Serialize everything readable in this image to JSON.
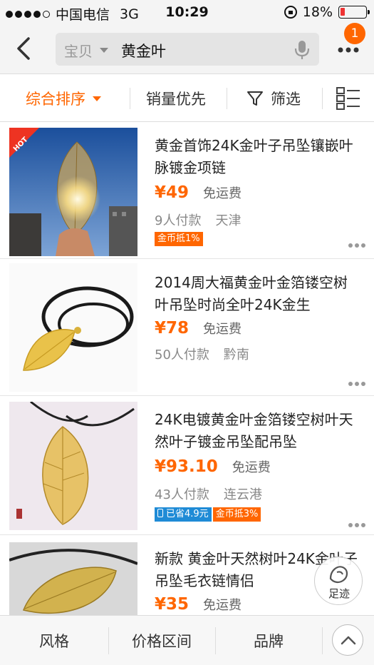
{
  "status_bar": {
    "carrier": "中国电信",
    "network": "3G",
    "time": "10:29",
    "battery": "18%",
    "battery_level": 0.18
  },
  "search": {
    "scope": "宝贝",
    "query": "黄金叶",
    "notification_count": "1"
  },
  "filters": {
    "sort": "综合排序",
    "sales_first": "销量优先",
    "filter": "筛选"
  },
  "colors": {
    "accent": "#ff6600",
    "tag_blue": "#1f8bd6"
  },
  "items": [
    {
      "title": "黄金首饰24K金叶子吊坠镶嵌叶脉镀金项链",
      "price": "¥49",
      "shipping": "免运费",
      "sales": "9人付款",
      "location": "天津",
      "hot": "HOT",
      "tags": [
        "金币抵1%"
      ]
    },
    {
      "title": "2014周大福黄金叶金箔镂空树叶吊坠时尚全叶24K金生",
      "price": "¥78",
      "shipping": "免运费",
      "sales": "50人付款",
      "location": "黔南"
    },
    {
      "title": "24K电镀黄金叶金箔镂空树叶天然叶子镀金吊坠配吊坠",
      "price": "¥93.10",
      "shipping": "免运费",
      "sales": "43人付款",
      "location": "连云港",
      "tags": [
        "已省4.9元",
        "金币抵3%"
      ]
    },
    {
      "title": "新款 黄金叶天然树叶24K金叶子吊坠毛衣链情侣",
      "price": "¥35",
      "shipping": "免运费"
    }
  ],
  "footprint_label": "足迹",
  "bottom_bar": {
    "style": "风格",
    "price_range": "价格区间",
    "brand": "品牌"
  }
}
